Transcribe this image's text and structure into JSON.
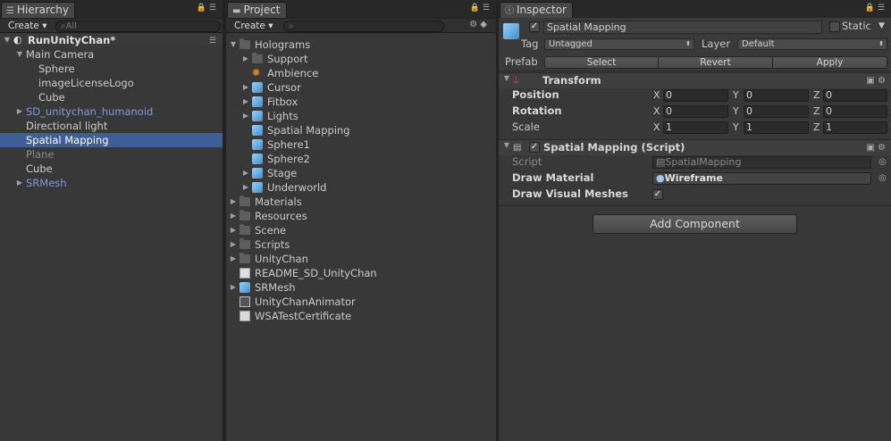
{
  "hierarchy": {
    "tab_label": "Hierarchy",
    "create_label": "Create ▾",
    "search_placeholder": "All",
    "scene_name": "RunUnityChan*",
    "items": [
      {
        "label": "Main Camera"
      },
      {
        "label": "Sphere"
      },
      {
        "label": "imageLicenseLogo"
      },
      {
        "label": "Cube"
      },
      {
        "label": "SD_unitychan_humanoid"
      },
      {
        "label": "Directional light"
      },
      {
        "label": "Spatial Mapping"
      },
      {
        "label": "Plane"
      },
      {
        "label": "Cube"
      },
      {
        "label": "SRMesh"
      }
    ]
  },
  "project": {
    "tab_label": "Project",
    "create_label": "Create ▾",
    "items": [
      {
        "label": "Holograms"
      },
      {
        "label": "Support"
      },
      {
        "label": "Ambience"
      },
      {
        "label": "Cursor"
      },
      {
        "label": "Fitbox"
      },
      {
        "label": "Lights"
      },
      {
        "label": "Spatial Mapping"
      },
      {
        "label": "Sphere1"
      },
      {
        "label": "Sphere2"
      },
      {
        "label": "Stage"
      },
      {
        "label": "Underworld"
      },
      {
        "label": "Materials"
      },
      {
        "label": "Resources"
      },
      {
        "label": "Scene"
      },
      {
        "label": "Scripts"
      },
      {
        "label": "UnityChan"
      },
      {
        "label": "README_SD_UnityChan"
      },
      {
        "label": "SRMesh"
      },
      {
        "label": "UnityChanAnimator"
      },
      {
        "label": "WSATestCertificate"
      }
    ]
  },
  "inspector": {
    "tab_label": "Inspector",
    "object_name": "Spatial Mapping",
    "static_label": "Static",
    "tag_label": "Tag",
    "tag_value": "Untagged",
    "layer_label": "Layer",
    "layer_value": "Default",
    "prefab_label": "Prefab",
    "prefab_select": "Select",
    "prefab_revert": "Revert",
    "prefab_apply": "Apply",
    "transform": {
      "title": "Transform",
      "position_label": "Position",
      "rotation_label": "Rotation",
      "scale_label": "Scale",
      "x": "X",
      "y": "Y",
      "z": "Z",
      "position": [
        "0",
        "0",
        "0"
      ],
      "rotation": [
        "0",
        "0",
        "0"
      ],
      "scale": [
        "1",
        "1",
        "1"
      ]
    },
    "script_component": {
      "title": "Spatial Mapping (Script)",
      "script_label": "Script",
      "script_value": "SpatialMapping",
      "draw_material_label": "Draw Material",
      "draw_material_value": "Wireframe",
      "draw_visual_meshes_label": "Draw Visual Meshes",
      "draw_visual_meshes": true
    },
    "add_component_label": "Add Component"
  },
  "colors": {
    "selection": "#3e5f96",
    "prefab_blue": "#7d9bda"
  }
}
